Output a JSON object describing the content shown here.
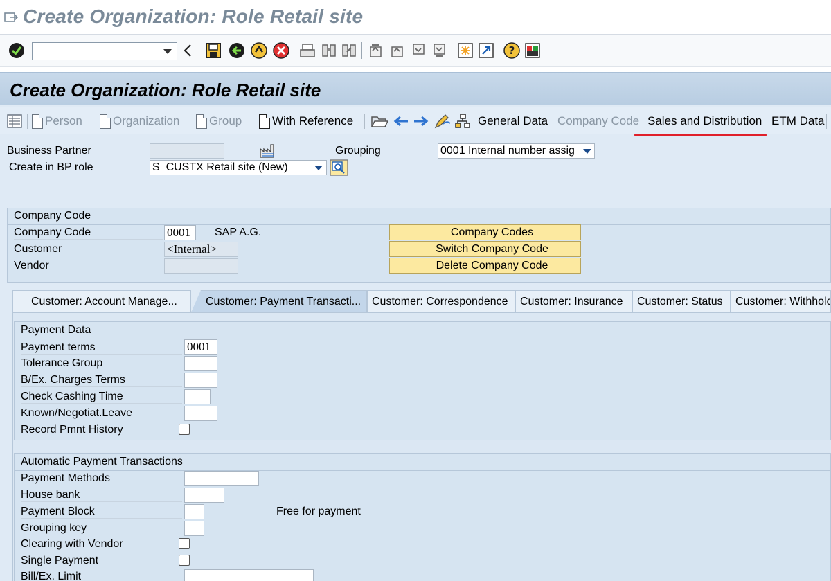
{
  "window": {
    "title": "Create Organization: Role Retail site"
  },
  "system_toolbar": {
    "command_field_value": ""
  },
  "screen": {
    "title": "Create Organization: Role Retail site"
  },
  "app_toolbar": {
    "buttons": [
      "Person",
      "Organization",
      "Group",
      "With Reference"
    ],
    "links": [
      "General Data",
      "Company Code",
      "Sales and Distribution",
      "ETM Data"
    ]
  },
  "header": {
    "business_partner_label": "Business Partner",
    "business_partner_value": "",
    "create_in_role_label": "Create in BP role",
    "create_in_role_value": "S_CUSTX Retail site (New)",
    "grouping_label": "Grouping",
    "grouping_value": "0001 Internal number assig"
  },
  "company_code_box": {
    "heading": "Company Code",
    "company_code_label": "Company Code",
    "company_code_value": "0001",
    "company_name": "SAP A.G.",
    "customer_label": "Customer",
    "customer_value": "<Internal>",
    "vendor_label": "Vendor",
    "vendor_value": "",
    "buttons": [
      "Company Codes",
      "Switch Company Code",
      "Delete Company Code"
    ]
  },
  "tabs": [
    "Customer: Account Manage...",
    "Customer: Payment Transacti...",
    "Customer: Correspondence",
    "Customer: Insurance",
    "Customer: Status",
    "Customer: Withhold"
  ],
  "payment_data": {
    "heading": "Payment Data",
    "payment_terms_label": "Payment terms",
    "payment_terms_value": "0001",
    "tolerance_group_label": "Tolerance Group",
    "bex_charges_label": "B/Ex. Charges Terms",
    "check_cashing_label": "Check Cashing Time",
    "known_negotiat_label": "Known/Negotiat.Leave",
    "record_pmnt_label": "Record Pmnt History"
  },
  "auto_payment": {
    "heading": "Automatic Payment Transactions",
    "payment_methods_label": "Payment Methods",
    "house_bank_label": "House bank",
    "payment_block_label": "Payment Block",
    "payment_block_text": "Free for payment",
    "grouping_key_label": "Grouping key",
    "clearing_vendor_label": "Clearing with Vendor",
    "single_payment_label": "Single Payment",
    "bill_ex_limit_label": "Bill/Ex. Limit"
  },
  "colors": {
    "screen_bg": "#dfeaf5",
    "title_bar": "#b8cde2",
    "highlight_underline": "#e0202a",
    "yellow_button": "#fce9a0"
  }
}
